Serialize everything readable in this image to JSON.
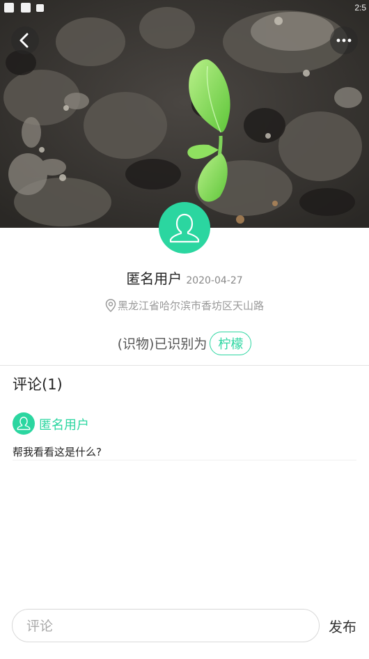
{
  "status_bar": {
    "time": "2:5"
  },
  "header": {
    "back_icon": "chevron-left-icon",
    "more_icon": "more-dots-icon"
  },
  "post": {
    "username": "匿名用户",
    "date": "2020-04-27",
    "location_icon": "location-pin-icon",
    "location": "黑龙江省哈尔滨市香坊区天山路",
    "result_prefix": "(识物)已识别为",
    "result_tag": "柠檬"
  },
  "comments": {
    "title": "评论(1)",
    "items": [
      {
        "username": "匿名用户",
        "text": "帮我看看这是什么?"
      }
    ]
  },
  "input_bar": {
    "placeholder": "评论",
    "value": "",
    "publish_label": "发布"
  },
  "colors": {
    "accent": "#2bd6a0",
    "divider": "#e3e3e3"
  }
}
